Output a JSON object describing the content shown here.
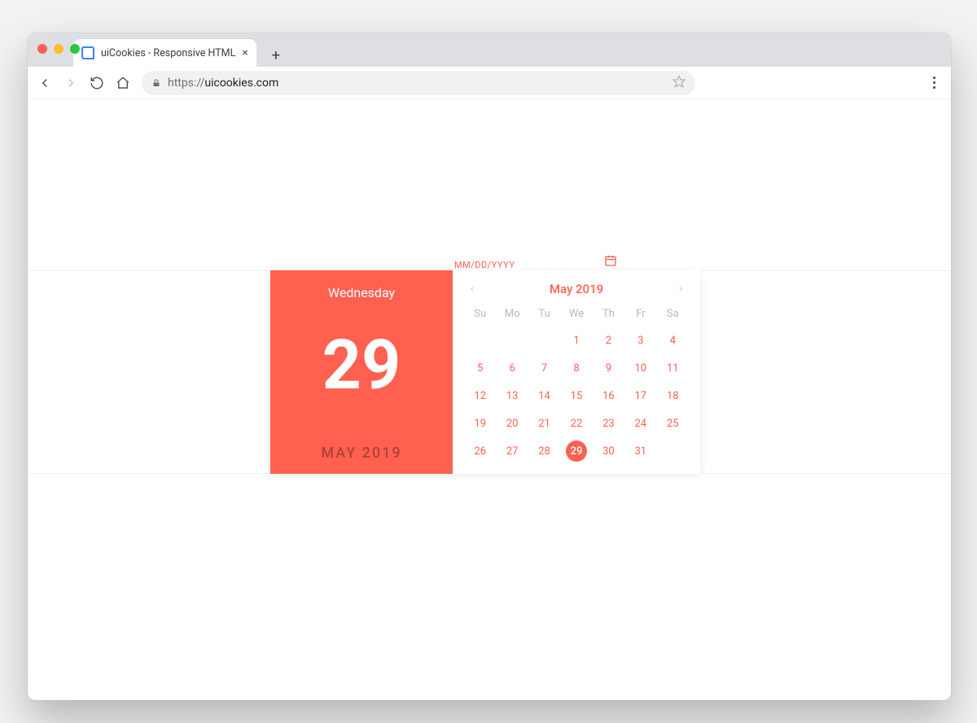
{
  "browser": {
    "tab_title": "uiCookies - Responsive HTML",
    "url_scheme": "https://",
    "url_host": "uicookies.com"
  },
  "datepicker": {
    "input_placeholder": "MM/DD/YYYY",
    "weekday": "Wednesday",
    "big_day": "29",
    "month_year_caps": "MAY  2019",
    "header_label": "May 2019",
    "dow": [
      "Su",
      "Mo",
      "Tu",
      "We",
      "Th",
      "Fr",
      "Sa"
    ],
    "leading_blanks": 3,
    "days": [
      "1",
      "2",
      "3",
      "4",
      "5",
      "6",
      "7",
      "8",
      "9",
      "10",
      "11",
      "12",
      "13",
      "14",
      "15",
      "16",
      "17",
      "18",
      "19",
      "20",
      "21",
      "22",
      "23",
      "24",
      "25",
      "26",
      "27",
      "28",
      "29",
      "30",
      "31"
    ],
    "selected_day": "29"
  },
  "colors": {
    "accent": "#ff604f"
  }
}
